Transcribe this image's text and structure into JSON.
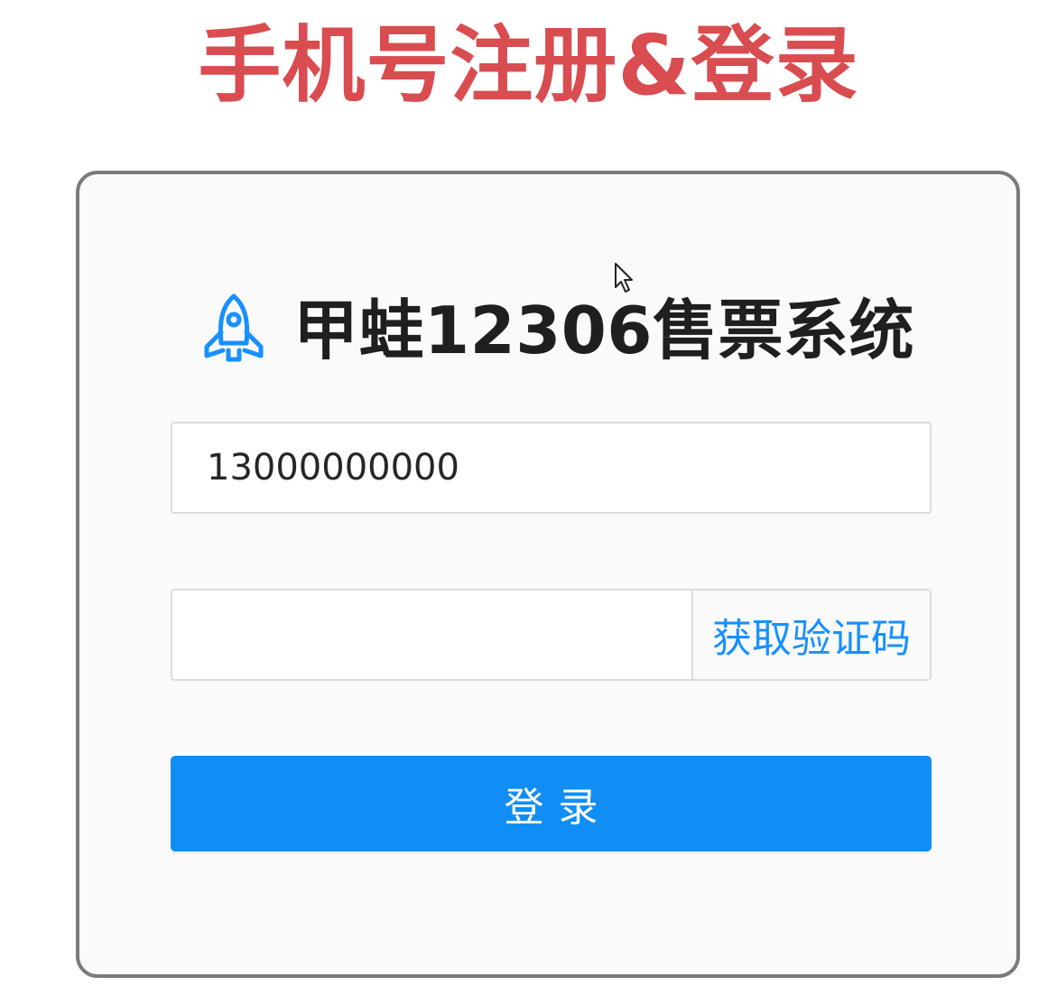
{
  "banner": {
    "title": "手机号注册&登录",
    "color": "#d94c4f"
  },
  "card": {
    "brand_icon": "rocket-icon",
    "brand_title": "甲蛙12306售票系统",
    "accent_color": "#1890ff"
  },
  "phone_input": {
    "value": "13000000000"
  },
  "code_input": {
    "value": "",
    "addon_label": "获取验证码"
  },
  "login_button": {
    "label": "登录",
    "color": "#108ef5"
  },
  "pointer": {
    "icon": "mouse-cursor-icon"
  }
}
